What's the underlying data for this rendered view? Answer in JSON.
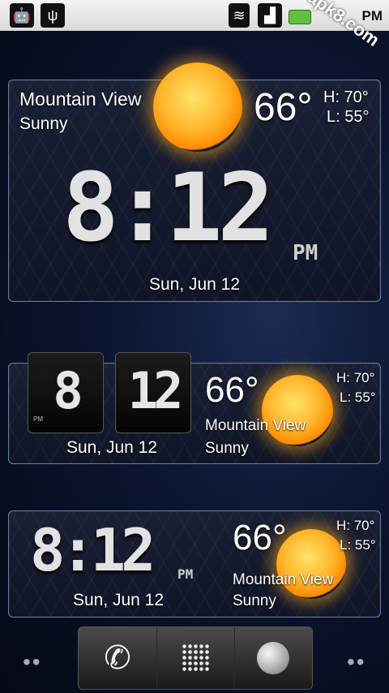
{
  "status_bar": {
    "time": "PM",
    "watermark": "apk8.com",
    "icons": [
      "android-icon",
      "usb-icon",
      "wifi-icon",
      "signal-icon",
      "battery-icon"
    ]
  },
  "widget1": {
    "city": "Mountain View",
    "condition": "Sunny",
    "temp": "66°",
    "high": "H: 70°",
    "low": "L: 55°",
    "time": "8:12",
    "ampm": "PM",
    "date": "Sun, Jun 12"
  },
  "widget2": {
    "hour": "8",
    "minute": "12",
    "ampm": "PM",
    "date": "Sun, Jun 12",
    "temp": "66°",
    "high": "H: 70°",
    "low": "L: 55°",
    "city": "Mountain View",
    "condition": "Sunny"
  },
  "widget3": {
    "time": "8:12",
    "ampm": "PM",
    "date": "Sun, Jun 12",
    "temp": "66°",
    "high": "H: 70°",
    "low": "L: 55°",
    "city": "Mountain View",
    "condition": "Sunny"
  },
  "dock": {
    "items": [
      "phone-icon",
      "app-drawer-icon",
      "browser-icon"
    ]
  },
  "colors": {
    "sun": "#ffb52a",
    "panel_border": "#6b7b9a"
  }
}
